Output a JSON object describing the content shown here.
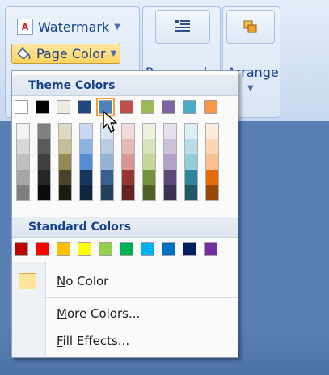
{
  "ribbon": {
    "watermark_label": "Watermark",
    "page_color_label": "Page Color",
    "paragraph_label": "Paragraph",
    "arrange_label": "Arrange"
  },
  "menu": {
    "theme_title": "Theme Colors",
    "standard_title": "Standard Colors",
    "no_color": {
      "label": "No Color",
      "accel": "N"
    },
    "more_colors": {
      "label": "More Colors...",
      "accel": "M"
    },
    "fill_effects": {
      "label": "Fill Effects...",
      "accel": "F"
    },
    "theme_colors": [
      "#ffffff",
      "#000000",
      "#eeece1",
      "#1f497d",
      "#4f81bd",
      "#c0504d",
      "#9bbb59",
      "#8064a2",
      "#4bacc6",
      "#f79646"
    ],
    "theme_shades": [
      [
        "#f2f2f2",
        "#d8d8d8",
        "#bfbfbf",
        "#a5a5a5",
        "#7f7f7f"
      ],
      [
        "#7f7f7f",
        "#595959",
        "#3f3f3f",
        "#262626",
        "#0c0c0c"
      ],
      [
        "#ddd9c3",
        "#c4bd97",
        "#938953",
        "#494429",
        "#1d1b10"
      ],
      [
        "#c6d9f0",
        "#8db3e2",
        "#548dd4",
        "#17365d",
        "#0f243e"
      ],
      [
        "#dbe5f1",
        "#b8cce4",
        "#95b3d7",
        "#366092",
        "#244061"
      ],
      [
        "#f2dcdb",
        "#e5b9b7",
        "#d99694",
        "#953734",
        "#632423"
      ],
      [
        "#ebf1dd",
        "#d7e3bc",
        "#c3d69b",
        "#76923c",
        "#4f6128"
      ],
      [
        "#e5e0ec",
        "#ccc1d9",
        "#b2a2c7",
        "#5f497a",
        "#3f3151"
      ],
      [
        "#dbeef3",
        "#b7dde8",
        "#92cddc",
        "#31859b",
        "#205867"
      ],
      [
        "#fdeada",
        "#fbd5b5",
        "#fac08f",
        "#e36c09",
        "#974806"
      ]
    ],
    "standard_colors": [
      "#c00000",
      "#ff0000",
      "#ffc000",
      "#ffff00",
      "#92d050",
      "#00b050",
      "#00b0f0",
      "#0070c0",
      "#002060",
      "#7030a0"
    ],
    "selected_theme_index": 4
  }
}
